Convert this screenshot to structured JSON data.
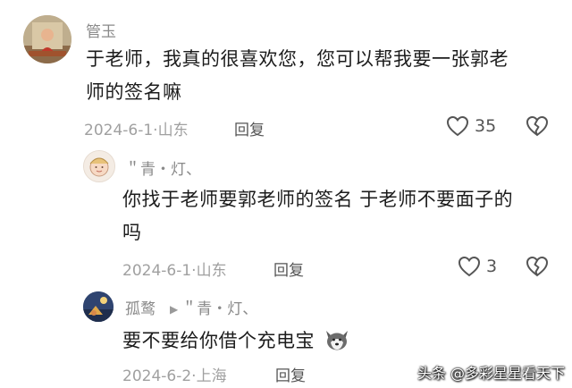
{
  "comments": [
    {
      "username": "管玉",
      "text_lines": [
        "于老师，我真的很喜欢您，您可以帮我要一张郭老",
        "师的签名嘛"
      ],
      "date": "2024-6-1",
      "location": "山东",
      "reply_label": "回复",
      "likes": "35",
      "like_icon": "heart-outline-icon",
      "dislike_icon": "broken-heart-icon"
    },
    {
      "username": "＂青・灯、",
      "text_lines": [
        "你找于老师要郭老师的签名 于老师不要面子的",
        "吗"
      ],
      "date": "2024-6-1",
      "location": "山东",
      "reply_label": "回复",
      "likes": "3",
      "like_icon": "heart-outline-icon",
      "dislike_icon": "broken-heart-icon"
    },
    {
      "username": "孤鹜",
      "reply_to": "＂青・灯、",
      "text": "要不要给你借个充电宝",
      "emoji_icon": "husky-dog-emoji-icon",
      "date": "2024-6-2",
      "location": "上海",
      "reply_label": "回复"
    }
  ],
  "watermark": "头条 @多彩星星看天下"
}
